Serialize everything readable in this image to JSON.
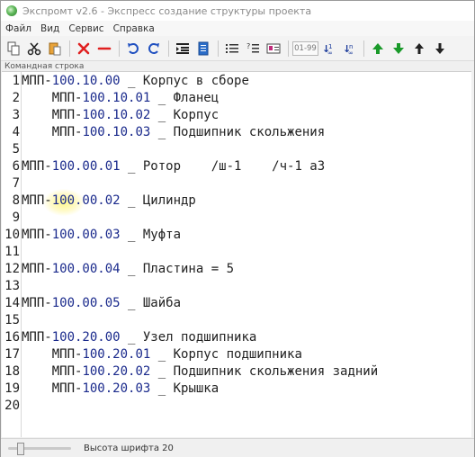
{
  "window": {
    "title": "Экспромт v2.6 - Экспресс создание структуры проекта"
  },
  "menu": [
    "Файл",
    "Вид",
    "Сервис",
    "Справка"
  ],
  "toolbar": {
    "range_box": "01-99",
    "icons": [
      "copy-icon",
      "cut-icon",
      "paste-icon",
      "delete-icon",
      "remove-icon",
      "undo-icon",
      "redo-icon",
      "indent-icon",
      "document-icon",
      "list-icon",
      "numbered-list-icon",
      "card-icon",
      "range-box",
      "subscript-numbering-icon",
      "superscript-numbering-icon",
      "move-up-icon",
      "move-down-icon",
      "move-top-icon",
      "move-bottom-icon"
    ]
  },
  "command_line_label": "Командная строка",
  "editor": {
    "lines": [
      {
        "n": "1",
        "indent": "",
        "prefix": "МПП-",
        "code": "100.10.00",
        "name": " _ Корпус в сборе"
      },
      {
        "n": "2",
        "indent": "    ",
        "prefix": "МПП-",
        "code": "100.10.01",
        "name": " _ Фланец"
      },
      {
        "n": "3",
        "indent": "    ",
        "prefix": "МПП-",
        "code": "100.10.02",
        "name": " _ Корпус"
      },
      {
        "n": "4",
        "indent": "    ",
        "prefix": "МПП-",
        "code": "100.10.03",
        "name": " _ Подшипник скольжения"
      },
      {
        "n": "5",
        "indent": "",
        "prefix": "",
        "code": "",
        "name": ""
      },
      {
        "n": "6",
        "indent": "",
        "prefix": "МПП-",
        "code": "100.00.01",
        "name": " _ Ротор    /ш-1    /ч-1 а3"
      },
      {
        "n": "7",
        "indent": "",
        "prefix": "",
        "code": "",
        "name": ""
      },
      {
        "n": "8",
        "indent": "",
        "prefix": "МПП-",
        "code": "100.00.02",
        "name": " _ Цилиндр"
      },
      {
        "n": "9",
        "indent": "",
        "prefix": "",
        "code": "",
        "name": ""
      },
      {
        "n": "10",
        "indent": "",
        "prefix": "МПП-",
        "code": "100.00.03",
        "name": " _ Муфта"
      },
      {
        "n": "11",
        "indent": "",
        "prefix": "",
        "code": "",
        "name": ""
      },
      {
        "n": "12",
        "indent": "",
        "prefix": "МПП-",
        "code": "100.00.04",
        "name": " _ Пластина = 5"
      },
      {
        "n": "13",
        "indent": "",
        "prefix": "",
        "code": "",
        "name": ""
      },
      {
        "n": "14",
        "indent": "",
        "prefix": "МПП-",
        "code": "100.00.05",
        "name": " _ Шайба"
      },
      {
        "n": "15",
        "indent": "",
        "prefix": "",
        "code": "",
        "name": ""
      },
      {
        "n": "16",
        "indent": "",
        "prefix": "МПП-",
        "code": "100.20.00",
        "name": " _ Узел подшипника"
      },
      {
        "n": "17",
        "indent": "    ",
        "prefix": "МПП-",
        "code": "100.20.01",
        "name": " _ Корпус подшипника"
      },
      {
        "n": "18",
        "indent": "    ",
        "prefix": "МПП-",
        "code": "100.20.02",
        "name": " _ Подшипник скольжения задний"
      },
      {
        "n": "19",
        "indent": "    ",
        "prefix": "МПП-",
        "code": "100.20.03",
        "name": " _ Крышка"
      },
      {
        "n": "20",
        "indent": "",
        "prefix": "",
        "code": "",
        "name": ""
      }
    ]
  },
  "status": {
    "font_height": "Высота шрифта 20",
    "font_slider_level": 0.15
  },
  "colors": {
    "code": "#1a2a8c",
    "delete": "#e02020",
    "undo": "#2050c0",
    "arrows_green": "#1a9a2a"
  }
}
